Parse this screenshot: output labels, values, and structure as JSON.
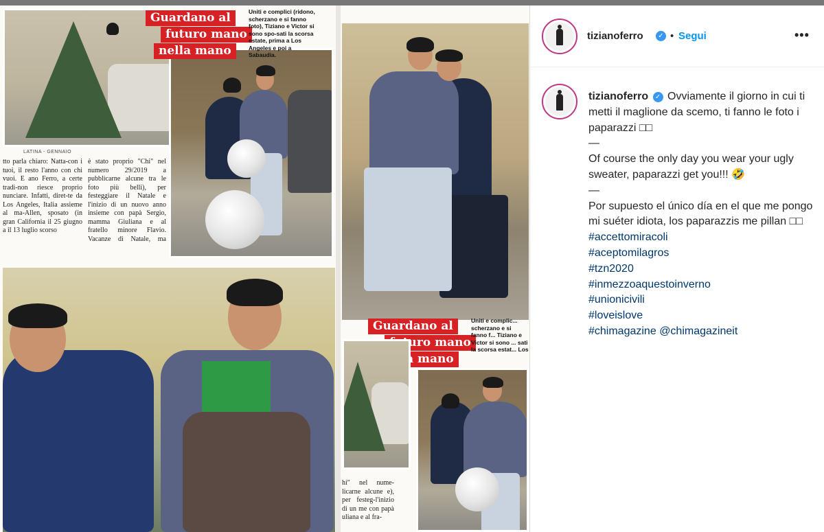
{
  "post": {
    "magazine": {
      "headline_top": [
        "Guardano al",
        "futuro mano",
        "nella mano"
      ],
      "headline_bottom": [
        "Guardano al",
        "futuro mano",
        "nella mano"
      ],
      "top_caption": "Uniti e complici (ridono, scherzano e si fanno foto), Tiziano e Victor si sono spo-sati la scorsa estate, prima a Los Angeles e poi a Sabaudia.",
      "bottom_caption": "Uniti e complic... scherzano e si fanno f... Tiziano e Victor si sono ... sati la scorsa estat... Los Angeles e poi a S...",
      "section_label": "LATINA - GENNAIO",
      "col1": "tto parla chiaro: Natta-con i tuoi, il resto l'anno con chi vuoi. E ano Ferro, a certe tradi-non riesce proprio nunciare. Infatti, diret-te da Los Angeles, Italia assieme al ma-Allen, sposato (in gran California il 25 giugno a il 13 luglio scorso",
      "col2": "è stato proprio \"Chi\" nel numero 29/2019 a pubblicarne alcune tra le foto più belli), per festeggiare il Natale e l'inizio di un nuovo anno insieme con papà Sergio, mamma Giuliana e al fratello minore Flavio. Vacanze di Natale, ma anche vacanze d'amore e di relax come raccontano le immagini esclusive di \"Chi\" che immortalano i •••",
      "col3": "hi\" nel nume-licarne alcune e), per festeg-l'inizio di un me con papà uliana e al fra-"
    }
  },
  "header": {
    "username": "tizianoferro",
    "separator": "•",
    "follow_label": "Segui",
    "more_label": "•••"
  },
  "caption": {
    "username": "tizianoferro",
    "italian": "Ovviamente il giorno in cui ti metti il maglione da scemo, ti fanno le foto i paparazzi □□",
    "dash1": "—",
    "english": "Of course the only day you wear your ugly sweater, paparazzi get you!!! 🤣",
    "dash2": "—",
    "spanish": "Por supuesto el único día en el que me pongo mi suéter idiota, los paparazzis me pillan □□",
    "hashtags": [
      "#accettomiracoli",
      "#aceptomilagros",
      "#tzn2020",
      "#inmezzoaquestoinverno",
      "#unionicivili",
      "#loveislove",
      "#chimagazine"
    ],
    "mention": "@chimagazineit"
  },
  "colors": {
    "link": "#00376b",
    "follow": "#0095f6",
    "verified": "#3897f0",
    "headline_red": "#d72125"
  },
  "icons": {
    "verified": "verified-badge-icon",
    "more": "more-options-icon"
  }
}
